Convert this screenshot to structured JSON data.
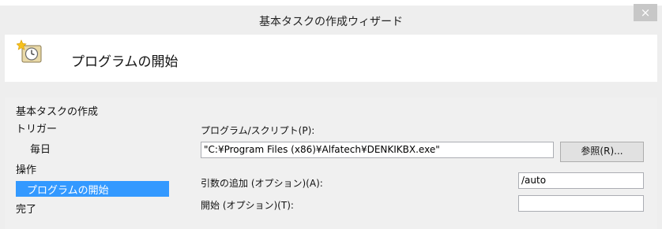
{
  "window": {
    "title": "基本タスクの作成ウィザード",
    "close_label": "×"
  },
  "header": {
    "title": "プログラムの開始"
  },
  "nav": {
    "section_label": "基本タスクの作成",
    "items": [
      {
        "label": "トリガー"
      },
      {
        "label": "毎日"
      },
      {
        "label": "操作"
      },
      {
        "label": "プログラムの開始",
        "selected": true
      },
      {
        "label": "完了"
      }
    ]
  },
  "form": {
    "program_label": "プログラム/スクリプト(P):",
    "program_value": "\"C:¥Program Files (x86)¥Alfatech¥DENKIKBX.exe\"",
    "browse_label": "参照(R)...",
    "args_label": "引数の追加 (オプション)(A):",
    "args_value": "/auto",
    "start_label": "開始 (オプション)(T):",
    "start_value": ""
  },
  "colors": {
    "selection": "#3399ff",
    "frame": "#eeeeee",
    "panel": "#f0f0f0"
  },
  "icons": {
    "header": "scheduled-task-clock-icon"
  }
}
